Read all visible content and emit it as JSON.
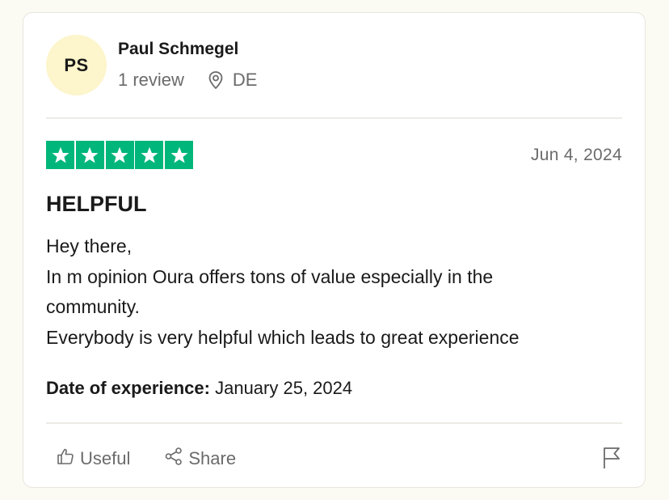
{
  "reviewer": {
    "initials": "PS",
    "name": "Paul Schmegel",
    "review_count": "1 review",
    "country": "DE",
    "location_icon": "location-pin-icon"
  },
  "rating": {
    "stars": 5,
    "max_stars": 5,
    "color": "#00b67a"
  },
  "review": {
    "date": "Jun 4, 2024",
    "title": "HELPFUL",
    "body_lines": [
      "Hey there,",
      "In m opinion Oura offers tons of value especially in the",
      "community.",
      "Everybody is very helpful which leads to great experience"
    ],
    "experience_label": "Date of experience:",
    "experience_date": "January 25, 2024"
  },
  "actions": {
    "useful_label": "Useful",
    "useful_icon": "thumbs-up-icon",
    "share_label": "Share",
    "share_icon": "share-icon",
    "report_icon": "flag-icon"
  },
  "colors": {
    "page_background": "#fcfbf3",
    "avatar_background": "#fdf5cb",
    "star_green": "#00b67a",
    "muted_text": "#6b6b6b"
  }
}
